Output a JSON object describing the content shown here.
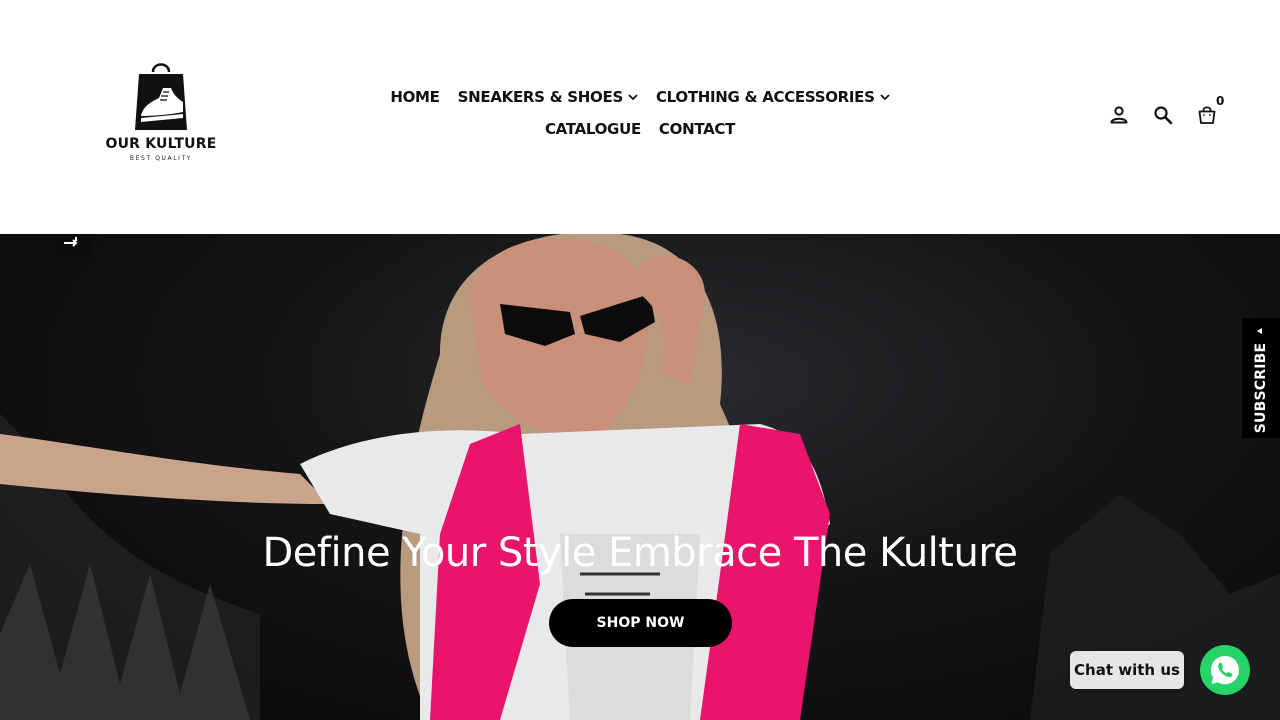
{
  "brand": {
    "name": "OUR KULTURE",
    "tagline": "BEST QUALITY"
  },
  "nav": {
    "items": [
      {
        "label": "HOME",
        "has_dropdown": false
      },
      {
        "label": "SNEAKERS & SHOES",
        "has_dropdown": true
      },
      {
        "label": "CLOTHING & ACCESSORIES",
        "has_dropdown": true
      },
      {
        "label": "CATALOGUE",
        "has_dropdown": false
      },
      {
        "label": "CONTACT",
        "has_dropdown": false
      }
    ]
  },
  "header_icons": {
    "account": "account-icon",
    "search": "search-icon",
    "cart": "shopping-bag-icon",
    "cart_count": "0"
  },
  "hero": {
    "title": "Define Your Style Embrace The Kulture",
    "cta_label": "SHOP NOW",
    "slide_control_icon": "shuffle-icon"
  },
  "subscribe": {
    "label": "SUBSCRIBE"
  },
  "chat": {
    "label": "Chat with us",
    "icon": "whatsapp-icon",
    "color": "#25d366"
  }
}
